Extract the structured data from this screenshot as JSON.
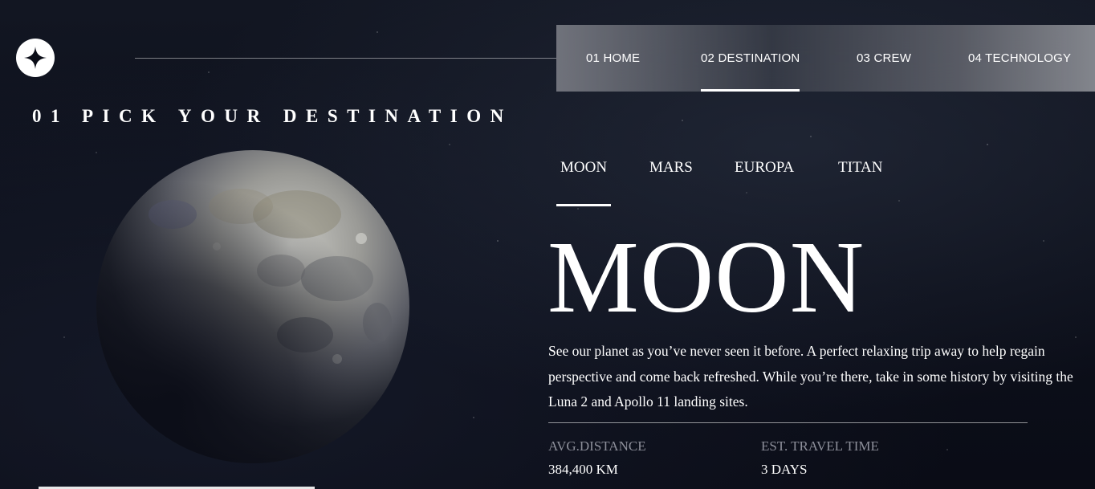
{
  "header": {
    "logo_icon": "four-point-star-icon",
    "nav": [
      {
        "number": "01",
        "label": "HOME",
        "text": "01 HOME",
        "active": false
      },
      {
        "number": "02",
        "label": "DESTINATION",
        "text": "02 DESTINATION",
        "active": true
      },
      {
        "number": "03",
        "label": "CREW",
        "text": "03 CREW",
        "active": false
      },
      {
        "number": "04",
        "label": "TECHNOLOGY",
        "text": "04 TECHNOLOGY",
        "active": false
      }
    ]
  },
  "heading": {
    "number": "01",
    "title": "PICK YOUR DESTINATION"
  },
  "tabs": [
    {
      "label": "MOON",
      "active": true
    },
    {
      "label": "MARS",
      "active": false
    },
    {
      "label": "EUROPA",
      "active": false
    },
    {
      "label": "TITAN",
      "active": false
    }
  ],
  "destination": {
    "name": "MOON",
    "description": "See our planet as you’ve never seen it before. A perfect relaxing trip away to help regain perspective and come back refreshed. While you’re there, take in some history by visiting the Luna 2 and Apollo 11 landing sites.",
    "image": "moon-image",
    "stats": {
      "distance_label": "AVG.DISTANCE",
      "distance_value": "384,400 KM",
      "travel_label": "EST. TRAVEL TIME",
      "travel_value": "3 DAYS"
    }
  },
  "colors": {
    "background": "#0b0d17",
    "text": "#ffffff",
    "muted": "#8d8f9a"
  }
}
